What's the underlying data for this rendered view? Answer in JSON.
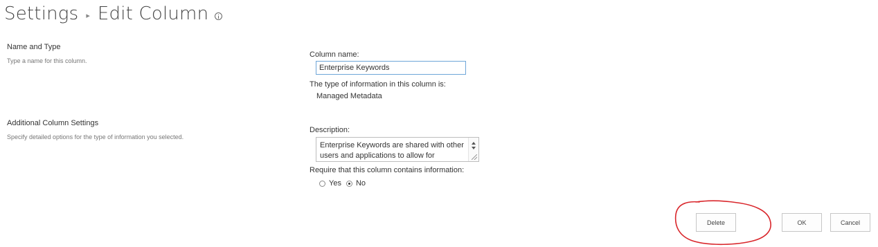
{
  "header": {
    "breadcrumb_root": "Settings",
    "breadcrumb_current": "Edit Column"
  },
  "sections": [
    {
      "heading": "Name and Type",
      "description": "Type a name for this column."
    },
    {
      "heading": "Additional Column Settings",
      "description": "Specify detailed options for the type of information you selected."
    }
  ],
  "name_type": {
    "column_name_label": "Column name:",
    "column_name_value": "Enterprise Keywords",
    "type_label": "The type of information in this column is:",
    "type_value": "Managed Metadata"
  },
  "additional": {
    "description_label": "Description:",
    "description_value": "Enterprise Keywords are shared with other users and applications to allow for",
    "require_label": "Require that this column contains information:",
    "options": [
      {
        "label": "Yes",
        "checked": false
      },
      {
        "label": "No",
        "checked": true
      }
    ]
  },
  "buttons": {
    "delete": "Delete",
    "ok": "OK",
    "cancel": "Cancel"
  },
  "colors": {
    "annotation": "#d9262b",
    "input_focus_border": "#6ea6d8"
  }
}
